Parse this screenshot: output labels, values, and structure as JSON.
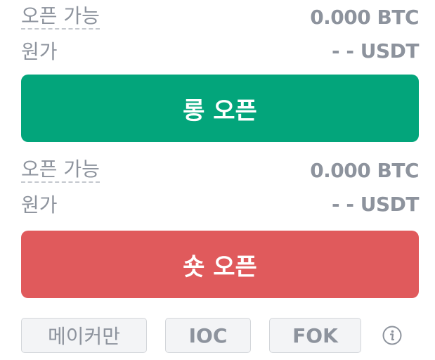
{
  "long_section": {
    "open_available_label": "오픈 가능",
    "open_available_value": "0.000 BTC",
    "cost_label": "원가",
    "cost_value": "- - USDT",
    "button_label": "롱 오픈"
  },
  "short_section": {
    "open_available_label": "오픈 가능",
    "open_available_value": "0.000 BTC",
    "cost_label": "원가",
    "cost_value": "- - USDT",
    "button_label": "숏 오픈"
  },
  "options": {
    "maker_label": "메이커만",
    "ioc_label": "IOC",
    "fok_label": "FOK"
  },
  "icons": {
    "info": "info-icon"
  },
  "colors": {
    "long": "#03a57b",
    "short": "#e05a5c",
    "text_muted": "#8d939d"
  }
}
